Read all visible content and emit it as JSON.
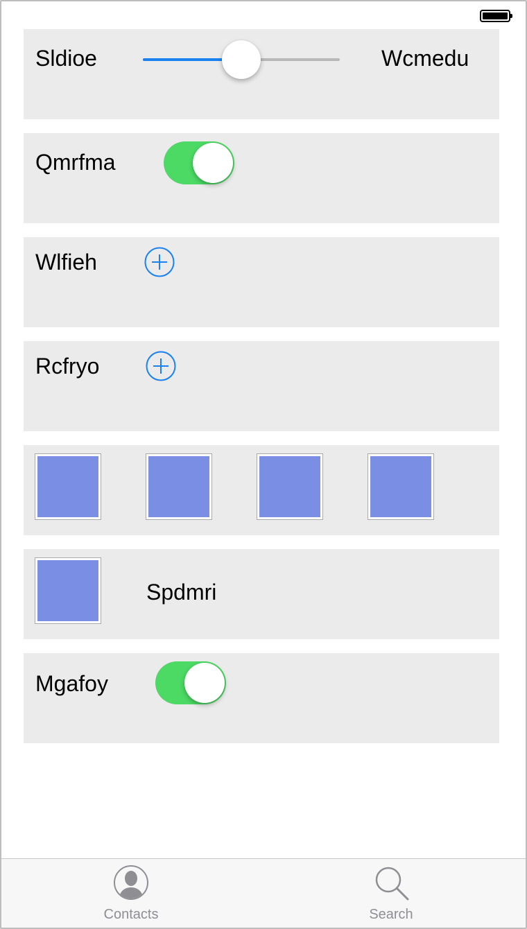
{
  "rows": {
    "slider_row": {
      "label": "Sldioe",
      "right_label": "Wcmedu",
      "value": 0.5
    },
    "switch_row_1": {
      "label": "Qmrfma",
      "on": true
    },
    "add_row_1": {
      "label": "Wlfieh"
    },
    "add_row_2": {
      "label": "Rcfryo"
    },
    "image_row": {
      "count": 4
    },
    "image_text_row": {
      "label": "Spdmri"
    },
    "switch_row_2": {
      "label": "Mgafoy",
      "on": true
    }
  },
  "tabbar": {
    "items": [
      {
        "label": "Contacts",
        "icon": "contacts-icon"
      },
      {
        "label": "Search",
        "icon": "search-icon"
      }
    ]
  },
  "colors": {
    "accent": "#1a82f0",
    "switch_on": "#4cd964",
    "panel_bg": "#ebebeb",
    "image_fill": "#7a8fe4"
  }
}
